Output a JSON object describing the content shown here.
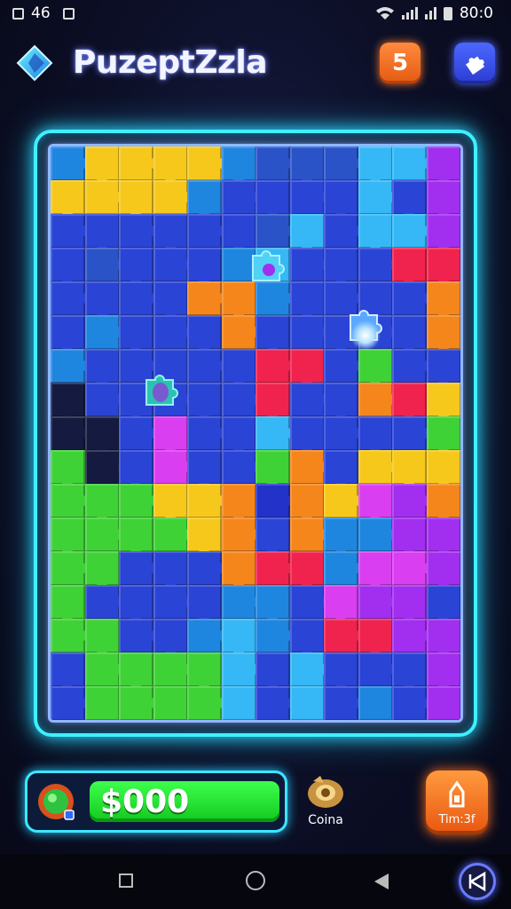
{
  "status_bar": {
    "time_left": "46",
    "time_right": "80:0"
  },
  "header": {
    "title": "PuzeptZzla",
    "orange_button_glyph": "5",
    "blue_button_icon": "puzzle-piece-icon"
  },
  "board": {
    "cols": 12,
    "rows": 17,
    "palette": {
      "B": "#2332c8",
      "N": "#2a44d6",
      "C": "#1f86e0",
      "L": "#35b8f5",
      "Y": "#f6c81c",
      "O": "#f5861c",
      "R": "#f0234e",
      "P": "#a22ef0",
      "M": "#d93ef0",
      "G": "#3fd236",
      "D": "#151a40",
      "T": "#2b53c8"
    },
    "cells": [
      "CYYYYCTTTLLP",
      "YYYYCNNNNLNP",
      "NNNNNNTLNLLP",
      "NTNNNCLNNNRR",
      "NNNNOOCNNNNO",
      "NCNNNONNNNNO",
      "CNNNNNRRNGNN",
      "DNNNNNRNNORY",
      "DDNMNNLNNNNG",
      "GDNMNNGONYYY",
      "GGGYYOBOYMPO",
      "GGGGYONOCCPP",
      "GGNNNORRCMMP",
      "GNNNNCCNMPPN",
      "GGNNCLCNRRPP",
      "NGGGGLNLNNNP",
      "NGGGGLNLNCNP"
    ]
  },
  "hud": {
    "coins_value": "$000",
    "coins_label": "Coina",
    "timer_label": "Tim:3f"
  },
  "nav": {
    "icons": [
      "recent-apps-icon",
      "home-icon",
      "back-icon",
      "assistant-icon"
    ]
  }
}
